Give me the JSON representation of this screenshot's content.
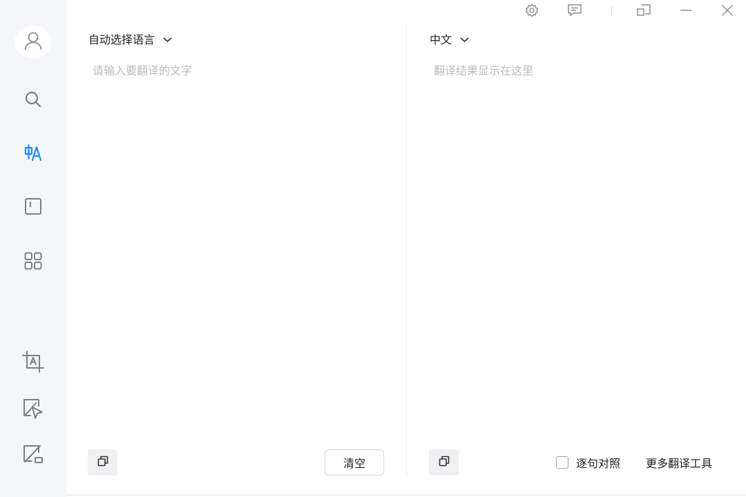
{
  "colors": {
    "sidebar_bg": "#f5f6f8",
    "accent": "#1a8cff",
    "icon": "#7a7e85",
    "placeholder": "#b8bcc2"
  },
  "sidebar": {
    "items": [
      {
        "icon": "user-avatar-icon"
      },
      {
        "icon": "search-icon"
      },
      {
        "icon": "translate-icon",
        "active": true
      },
      {
        "icon": "notebook-icon"
      },
      {
        "icon": "apps-grid-icon"
      },
      {
        "icon": "screenshot-translate-icon"
      },
      {
        "icon": "pointer-translate-icon"
      },
      {
        "icon": "disable-translate-icon"
      }
    ]
  },
  "window_controls": [
    "gear-icon",
    "feedback-icon",
    "pin-window-icon",
    "minimize-icon",
    "close-icon"
  ],
  "source": {
    "language": "自动选择语言",
    "placeholder": "请输入要翻译的文字",
    "value": "",
    "clear_label": "清空"
  },
  "target": {
    "language": "中文",
    "placeholder": "翻译结果显示在这里",
    "sentence_compare_label": "逐句对照",
    "sentence_compare_checked": false,
    "more_tools_label": "更多翻译工具"
  }
}
